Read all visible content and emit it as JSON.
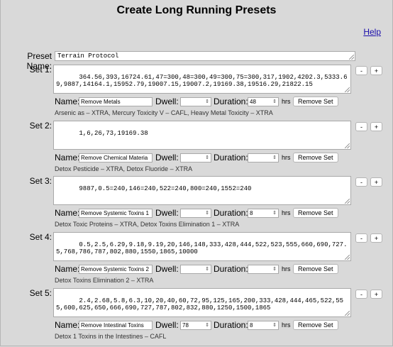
{
  "page": {
    "title": "Create Long Running Presets",
    "help_label": "Help",
    "preset_name_label": "Preset Name:",
    "preset_name_value": "Terrain Protocol"
  },
  "labels": {
    "name": "Name:",
    "dwell": "Dwell:",
    "duration": "Duration:",
    "hrs": "hrs",
    "remove_set": "Remove Set",
    "minus": "-",
    "plus": "+"
  },
  "sets": [
    {
      "label": "Set 1:",
      "frequencies": "364.56,393,16724.61,47=300,48=300,49=300,75=300,317,1902,4202.3,5333.69,9887,14164.1,15952.79,19007.15,19007.2,19169.38,19516.29,21822.15",
      "name": "Remove Metals",
      "dwell": "",
      "duration": "48",
      "description": "Arsenic as – XTRA, Mercury Toxicity V – CAFL, Heavy Metal Toxicity – XTRA"
    },
    {
      "label": "Set 2:",
      "frequencies": "1,6,26,73,19169.38",
      "name": "Remove Chemical Materia",
      "dwell": "",
      "duration": "",
      "description": "Detox Pesticide – XTRA, Detox Fluoride – XTRA"
    },
    {
      "label": "Set 3:",
      "frequencies": "9887,0.5=240,146=240,522=240,800=240,1552=240",
      "name": "Remove Systemic Toxins 1",
      "dwell": "",
      "duration": "8",
      "description": "Detox Toxic Proteins – XTRA, Detox Toxins Elimination 1 – XTRA"
    },
    {
      "label": "Set 4:",
      "frequencies": "0.5,2.5,6.29,9.18,9.19,20,146,148,333,428,444,522,523,555,660,690,727.5,768,786,787,802,880,1550,1865,10000",
      "name": "Remove Systemic Toxins 2",
      "dwell": "",
      "duration": "",
      "description": "Detox Toxins Elimination 2 – XTRA"
    },
    {
      "label": "Set 5:",
      "frequencies": "2.4,2.68,5.8,6.3,10,20,40,60,72,95,125,165,200,333,428,444,465,522,555,600,625,650,666,690,727,787,802,832,880,1250,1500,1865",
      "name": "Remove Intestinal Toxins",
      "dwell": "78",
      "duration": "8",
      "description": "Detox 1 Toxins in the Intestines – CAFL"
    }
  ]
}
